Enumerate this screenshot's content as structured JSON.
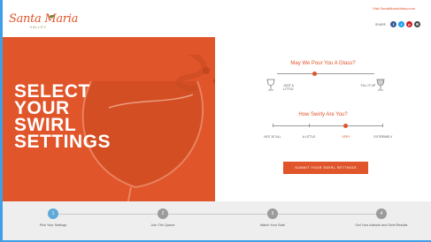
{
  "header": {
    "visit_link": "Visit SantaMariaValley.com",
    "logo_script": "Santa Maria",
    "logo_sub": "VALLEY",
    "share_label": "SHARE",
    "social": [
      {
        "icon": "facebook-icon",
        "glyph": "f",
        "color": "#3b5998"
      },
      {
        "icon": "twitter-icon",
        "glyph": "t",
        "color": "#1da1f2"
      },
      {
        "icon": "pinterest-icon",
        "glyph": "p",
        "color": "#cb2027"
      },
      {
        "icon": "email-icon",
        "glyph": "✉",
        "color": "#444444"
      }
    ]
  },
  "hero": {
    "title_line1": "SELECT",
    "title_line2": "YOUR",
    "title_line3": "SWIRL",
    "title_line4": "SETTINGS"
  },
  "panel": {
    "q1": "May We Pour You A Glass?",
    "pour_left": "JUST A LITTLE",
    "pour_right": "FILL IT UP",
    "pour_level": 0.45,
    "q2": "How Swirly Are You?",
    "swirl_options": [
      "NOT AT ALL",
      "A LITTLE",
      "VERY",
      "EXTREMELY"
    ],
    "swirl_selected": "VERY",
    "submit_label": "SUBMIT YOUR SWIRL SETTINGS"
  },
  "steps": [
    {
      "num": "1",
      "label": "Pick Your Settings"
    },
    {
      "num": "2",
      "label": "Join The Queue"
    },
    {
      "num": "3",
      "label": "Watch Your Swirl"
    },
    {
      "num": "4",
      "label": "Get Your Artwork and Swirl Results"
    }
  ],
  "colors": {
    "accent": "#e0552a",
    "active_step": "#5fa9d9",
    "frame": "#3fa0e8"
  }
}
